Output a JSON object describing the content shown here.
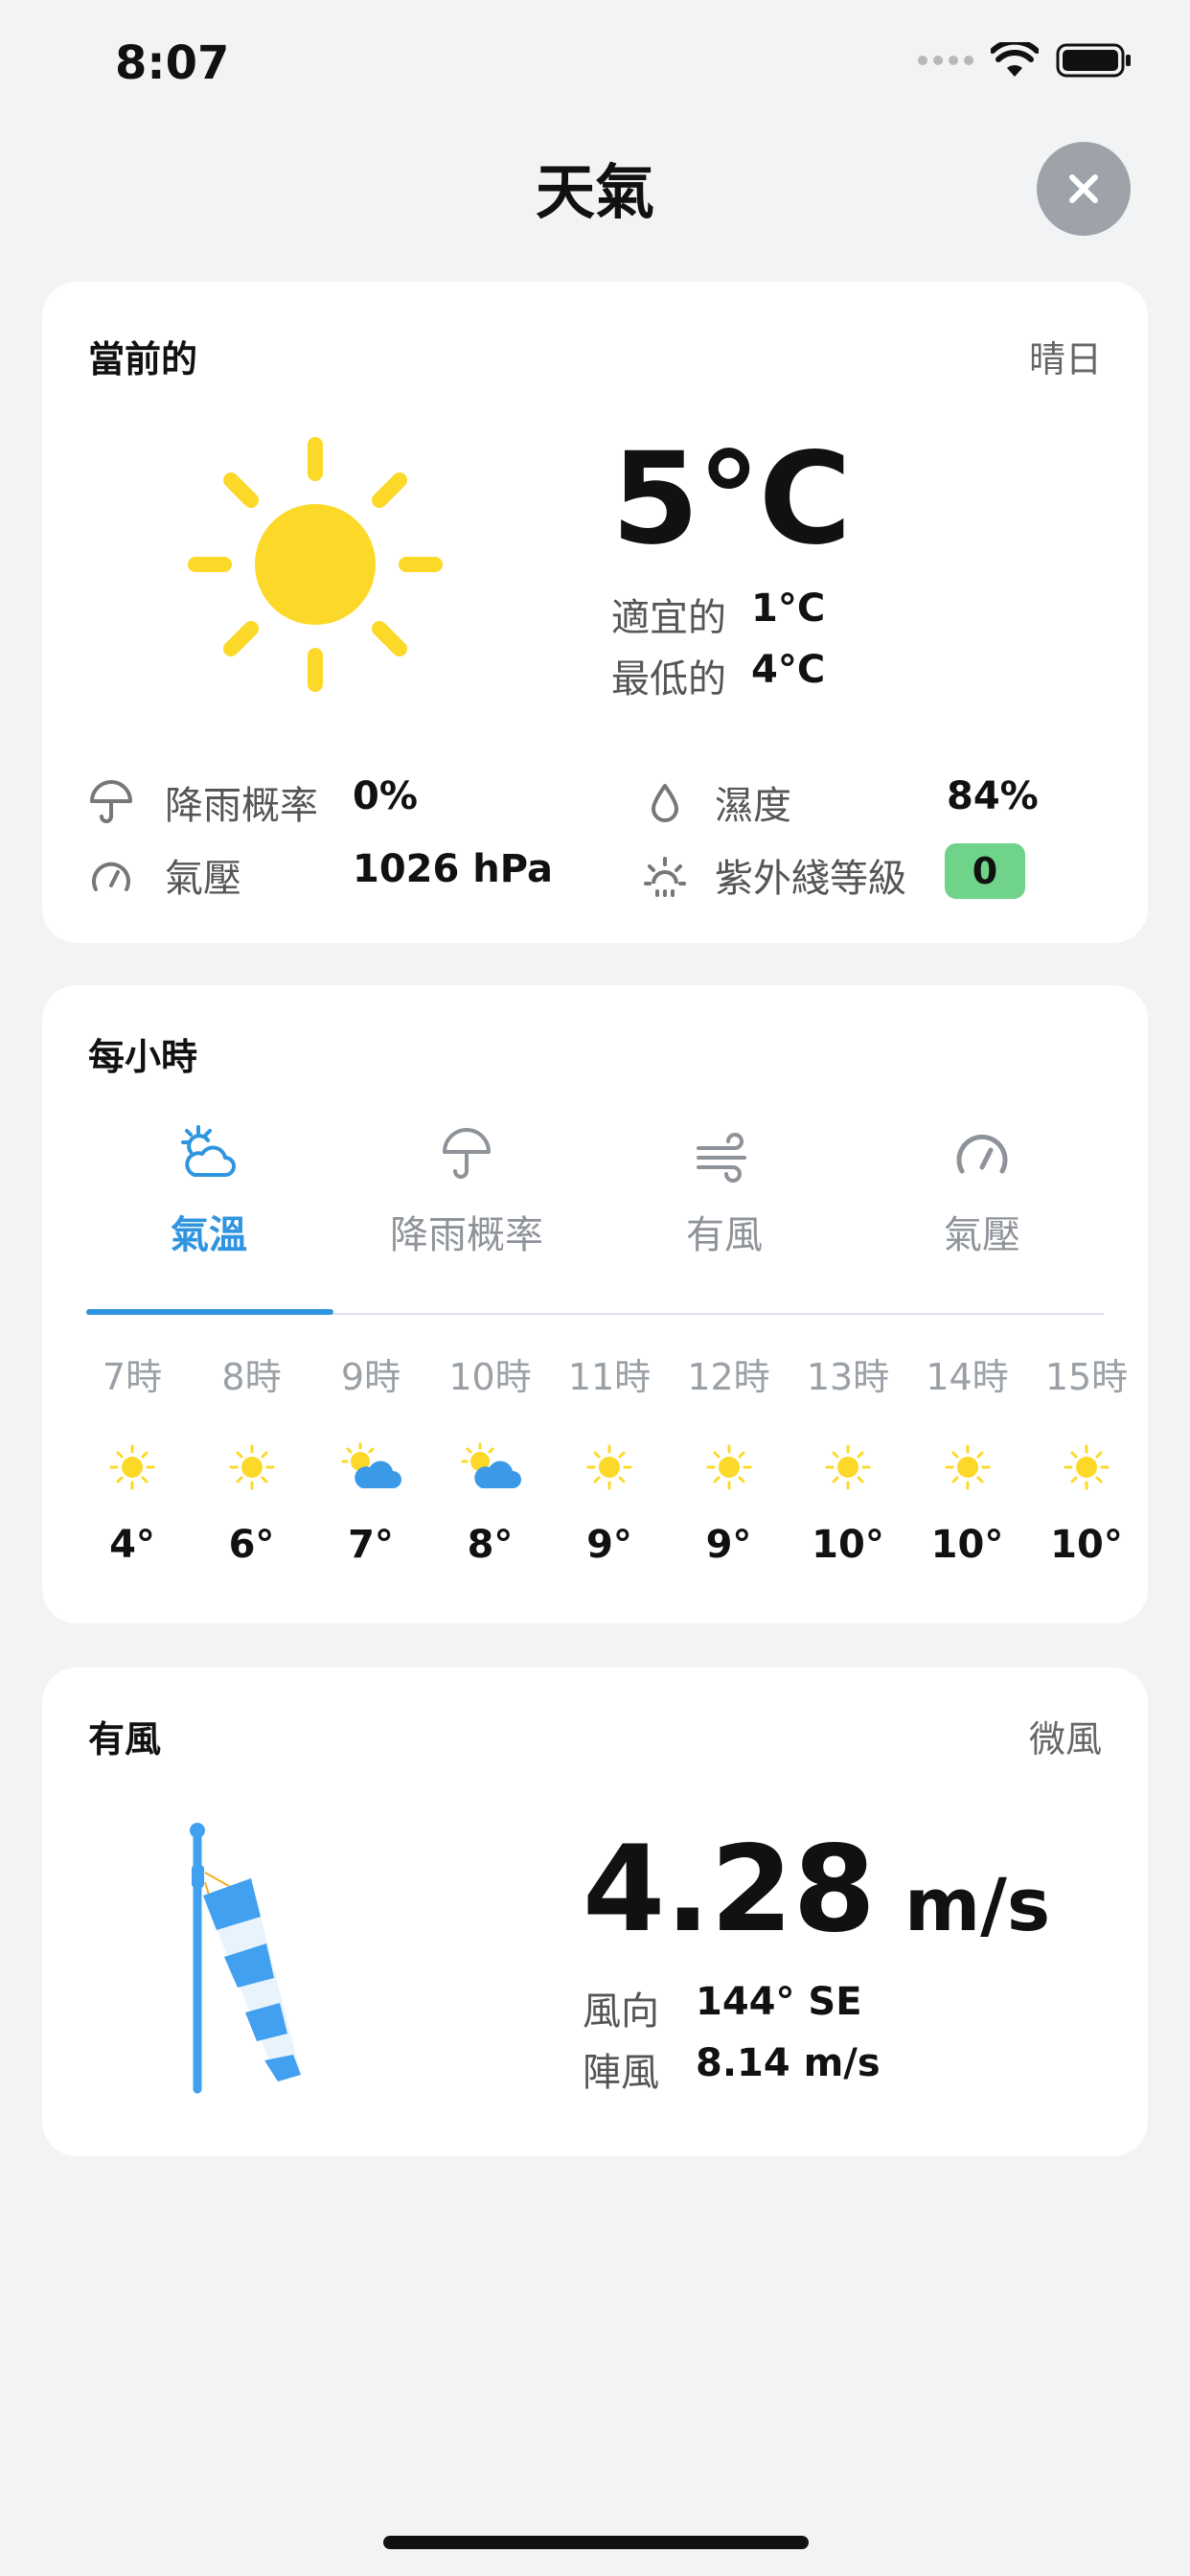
{
  "status_bar": {
    "time": "8:07"
  },
  "header": {
    "title": "天氣",
    "close_icon": "close-icon"
  },
  "current": {
    "title": "當前的",
    "condition": "晴日",
    "icon": "sun-icon",
    "temperature": "5°C",
    "feels_like_label": "適宜的",
    "feels_like_value": "1°C",
    "min_label": "最低的",
    "min_value": "4°C",
    "rain_label": "降雨概率",
    "rain_value": "0%",
    "humidity_label": "濕度",
    "humidity_value": "84%",
    "pressure_label": "氣壓",
    "pressure_value": "1026 hPa",
    "uv_label": "紫外綫等級",
    "uv_value": "0",
    "colors": {
      "sun": "#fcd928",
      "uv_badge": "#6fd38a"
    }
  },
  "hourly": {
    "title": "每小時",
    "tabs": [
      {
        "label": "氣溫",
        "icon": "sun-cloud-icon",
        "active": true
      },
      {
        "label": "降雨概率",
        "icon": "umbrella-icon",
        "active": false
      },
      {
        "label": "有風",
        "icon": "wind-icon",
        "active": false
      },
      {
        "label": "氣壓",
        "icon": "gauge-icon",
        "active": false
      }
    ],
    "hours": [
      {
        "time": "7時",
        "icon": "sun-icon",
        "temp": "4°"
      },
      {
        "time": "8時",
        "icon": "sun-icon",
        "temp": "6°"
      },
      {
        "time": "9時",
        "icon": "partly-cloudy-icon",
        "temp": "7°"
      },
      {
        "time": "10時",
        "icon": "partly-cloudy-icon",
        "temp": "8°"
      },
      {
        "time": "11時",
        "icon": "sun-icon",
        "temp": "9°"
      },
      {
        "time": "12時",
        "icon": "sun-icon",
        "temp": "9°"
      },
      {
        "time": "13時",
        "icon": "sun-icon",
        "temp": "10°"
      },
      {
        "time": "14時",
        "icon": "sun-icon",
        "temp": "10°"
      },
      {
        "time": "15時",
        "icon": "sun-icon",
        "temp": "10°"
      }
    ],
    "accent": "#2f95e0"
  },
  "wind": {
    "title": "有風",
    "condition": "微風",
    "icon": "windsock-icon",
    "speed": "4.28",
    "unit": "m/s",
    "direction_label": "風向",
    "direction_value": "144° SE",
    "gust_label": "陣風",
    "gust_value": "8.14 m/s"
  }
}
